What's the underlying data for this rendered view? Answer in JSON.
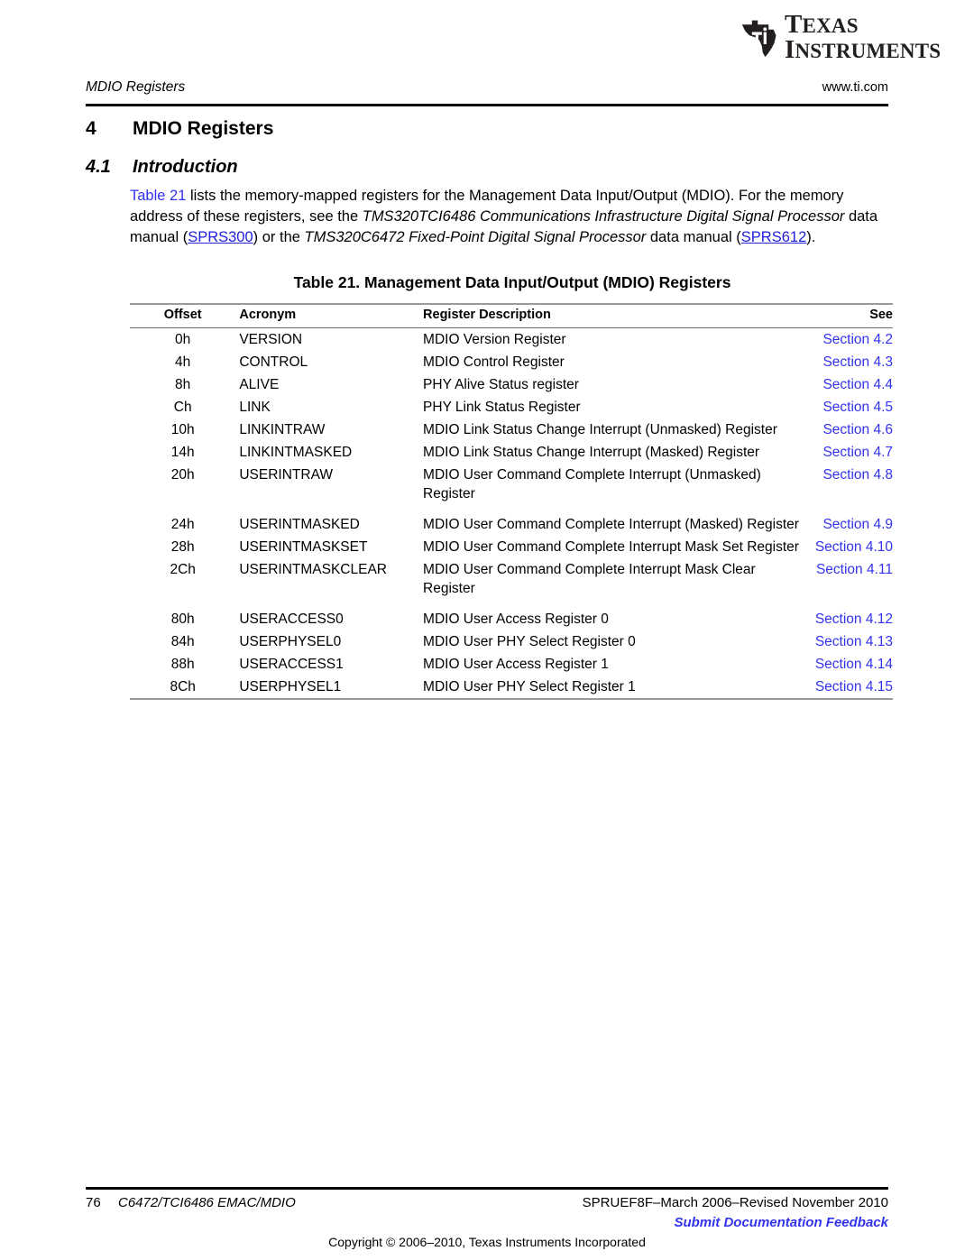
{
  "logo": {
    "icon": "ti-texas-logo",
    "line1": "Texas",
    "line2": "Instruments",
    "line1_cap": "T",
    "line1_rest": "EXAS",
    "line2_cap": "I",
    "line2_rest": "NSTRUMENTS"
  },
  "header": {
    "left": "MDIO Registers",
    "right": "www.ti.com"
  },
  "headings": {
    "h1_number": "4",
    "h1_title": "MDIO Registers",
    "h2_number": "4.1",
    "h2_title": "Introduction"
  },
  "intro": {
    "link_table": "Table 21",
    "text_1": " lists the memory-mapped registers for the Management Data Input/Output (MDIO). For the memory address of these registers, see the ",
    "italic_1": "TMS320TCI6486 Communications Infrastructure Digital Signal Processor",
    "text_2": " data manual (",
    "link_sprs300": "SPRS300",
    "text_3": ") or the ",
    "italic_2": "TMS320C6472 Fixed-Point Digital Signal Processor",
    "text_4": " data manual (",
    "link_sprs612": "SPRS612",
    "text_5": ")."
  },
  "table": {
    "caption": "Table 21. Management Data Input/Output (MDIO) Registers",
    "columns": [
      "Offset",
      "Acronym",
      "Register Description",
      "See"
    ],
    "rows": [
      {
        "offset": "0h",
        "acronym": "VERSION",
        "description": "MDIO Version Register",
        "see": "Section 4.2",
        "gap_before": false
      },
      {
        "offset": "4h",
        "acronym": "CONTROL",
        "description": "MDIO Control Register",
        "see": "Section 4.3",
        "gap_before": false
      },
      {
        "offset": "8h",
        "acronym": "ALIVE",
        "description": "PHY Alive Status register",
        "see": "Section 4.4",
        "gap_before": false
      },
      {
        "offset": "Ch",
        "acronym": "LINK",
        "description": "PHY Link Status Register",
        "see": "Section 4.5",
        "gap_before": false
      },
      {
        "offset": "10h",
        "acronym": "LINKINTRAW",
        "description": "MDIO Link Status Change Interrupt (Unmasked) Register",
        "see": "Section 4.6",
        "gap_before": false
      },
      {
        "offset": "14h",
        "acronym": "LINKINTMASKED",
        "description": "MDIO Link Status Change Interrupt (Masked) Register",
        "see": "Section 4.7",
        "gap_before": false
      },
      {
        "offset": "20h",
        "acronym": "USERINTRAW",
        "description": "MDIO User Command Complete Interrupt (Unmasked) Register",
        "see": "Section 4.8",
        "gap_before": false
      },
      {
        "offset": "24h",
        "acronym": "USERINTMASKED",
        "description": "MDIO User Command Complete Interrupt (Masked) Register",
        "see": "Section 4.9",
        "gap_before": true
      },
      {
        "offset": "28h",
        "acronym": "USERINTMASKSET",
        "description": "MDIO User Command Complete Interrupt Mask Set Register",
        "see": "Section 4.10",
        "gap_before": false
      },
      {
        "offset": "2Ch",
        "acronym": "USERINTMASKCLEAR",
        "description": "MDIO User Command Complete Interrupt Mask Clear Register",
        "see": "Section 4.11",
        "gap_before": false
      },
      {
        "offset": "80h",
        "acronym": "USERACCESS0",
        "description": "MDIO User Access Register 0",
        "see": "Section 4.12",
        "gap_before": true
      },
      {
        "offset": "84h",
        "acronym": "USERPHYSEL0",
        "description": "MDIO User PHY Select Register 0",
        "see": "Section 4.13",
        "gap_before": false
      },
      {
        "offset": "88h",
        "acronym": "USERACCESS1",
        "description": "MDIO User Access Register 1",
        "see": "Section 4.14",
        "gap_before": false
      },
      {
        "offset": "8Ch",
        "acronym": "USERPHYSEL1",
        "description": "MDIO User PHY Select Register 1",
        "see": "Section 4.15",
        "gap_before": false
      }
    ]
  },
  "footer": {
    "page_number": "76",
    "document_title": "C6472/TCI6486 EMAC/MDIO",
    "part_revision": "SPRUEF8F–March 2006–Revised November 2010",
    "feedback_link": "Submit Documentation Feedback",
    "copyright": "Copyright © 2006–2010, Texas Instruments Incorporated"
  },
  "colors": {
    "link_blue": "#3333ee",
    "rule_black": "#000000",
    "table_rule_gray": "#9a9a9a"
  }
}
